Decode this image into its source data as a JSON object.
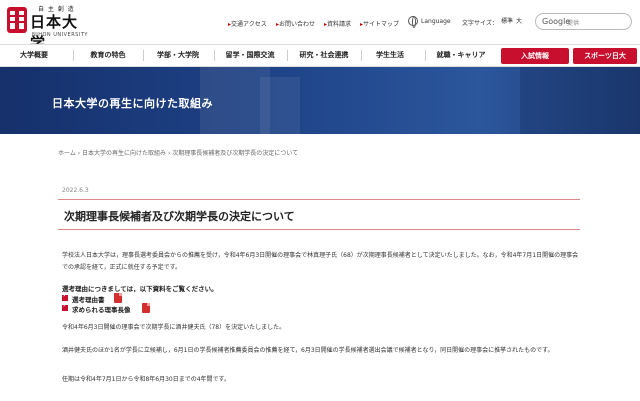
{
  "header": {
    "motto": "自 主 創 造",
    "name": "日本大学",
    "name_en": "NIHON UNIVERSITY",
    "util_links": [
      "交通アクセス",
      "お問い合わせ",
      "資料請求",
      "サイトマップ"
    ],
    "language": "Language",
    "font_size_label": "文字サイズ：",
    "font_size_options": [
      "標準",
      "大"
    ],
    "search_brand": "Google",
    "search_placeholder": "提供"
  },
  "nav": {
    "items": [
      "大学概要",
      "教育の特色",
      "学部・大学院",
      "留学・国際交流",
      "研究・社会連携",
      "学生生活",
      "就職・キャリア"
    ],
    "buttons": [
      "入試情報",
      "スポーツ日大"
    ],
    "accent": "#c8102e"
  },
  "hero": {
    "title": "日本大学の再生に向けた取組み"
  },
  "breadcrumb": "ホーム › 日本大学の再生に向けた取組み › 次期理事長候補者及び次期学長の決定について",
  "article": {
    "date": "2022.6.3",
    "title": "次期理事長候補者及び次期学長の決定について",
    "p1": "学校法人日本大学は，理事長選考委員会からの推薦を受け，令和4年6月3日開催の理事会で林真理子氏（68）が次期理事長候補者として決定いたしました。なお，令和4年7月1日開催の理事会での承認を経て，正式に就任する予定です。",
    "reason_title": "選考理由につきましては，以下資料をご覧ください。",
    "docs": [
      "選考理由書",
      "求められる理事長像"
    ],
    "p2": "令和4年6月3日開催の理事会で次期学長に酒井健夫氏（78）を決定いたしました。",
    "p3": "酒井健夫氏のほか1名が学長に立候補し，6月1日の学長候補者推薦委員会の推薦を経て，6月3日開催の学長候補者選出会議で候補者となり，同日開催の理事会に推挙されたものです。",
    "p4": "任期は令和4年7月1日から令和8年6月30日までの4年間です。"
  }
}
